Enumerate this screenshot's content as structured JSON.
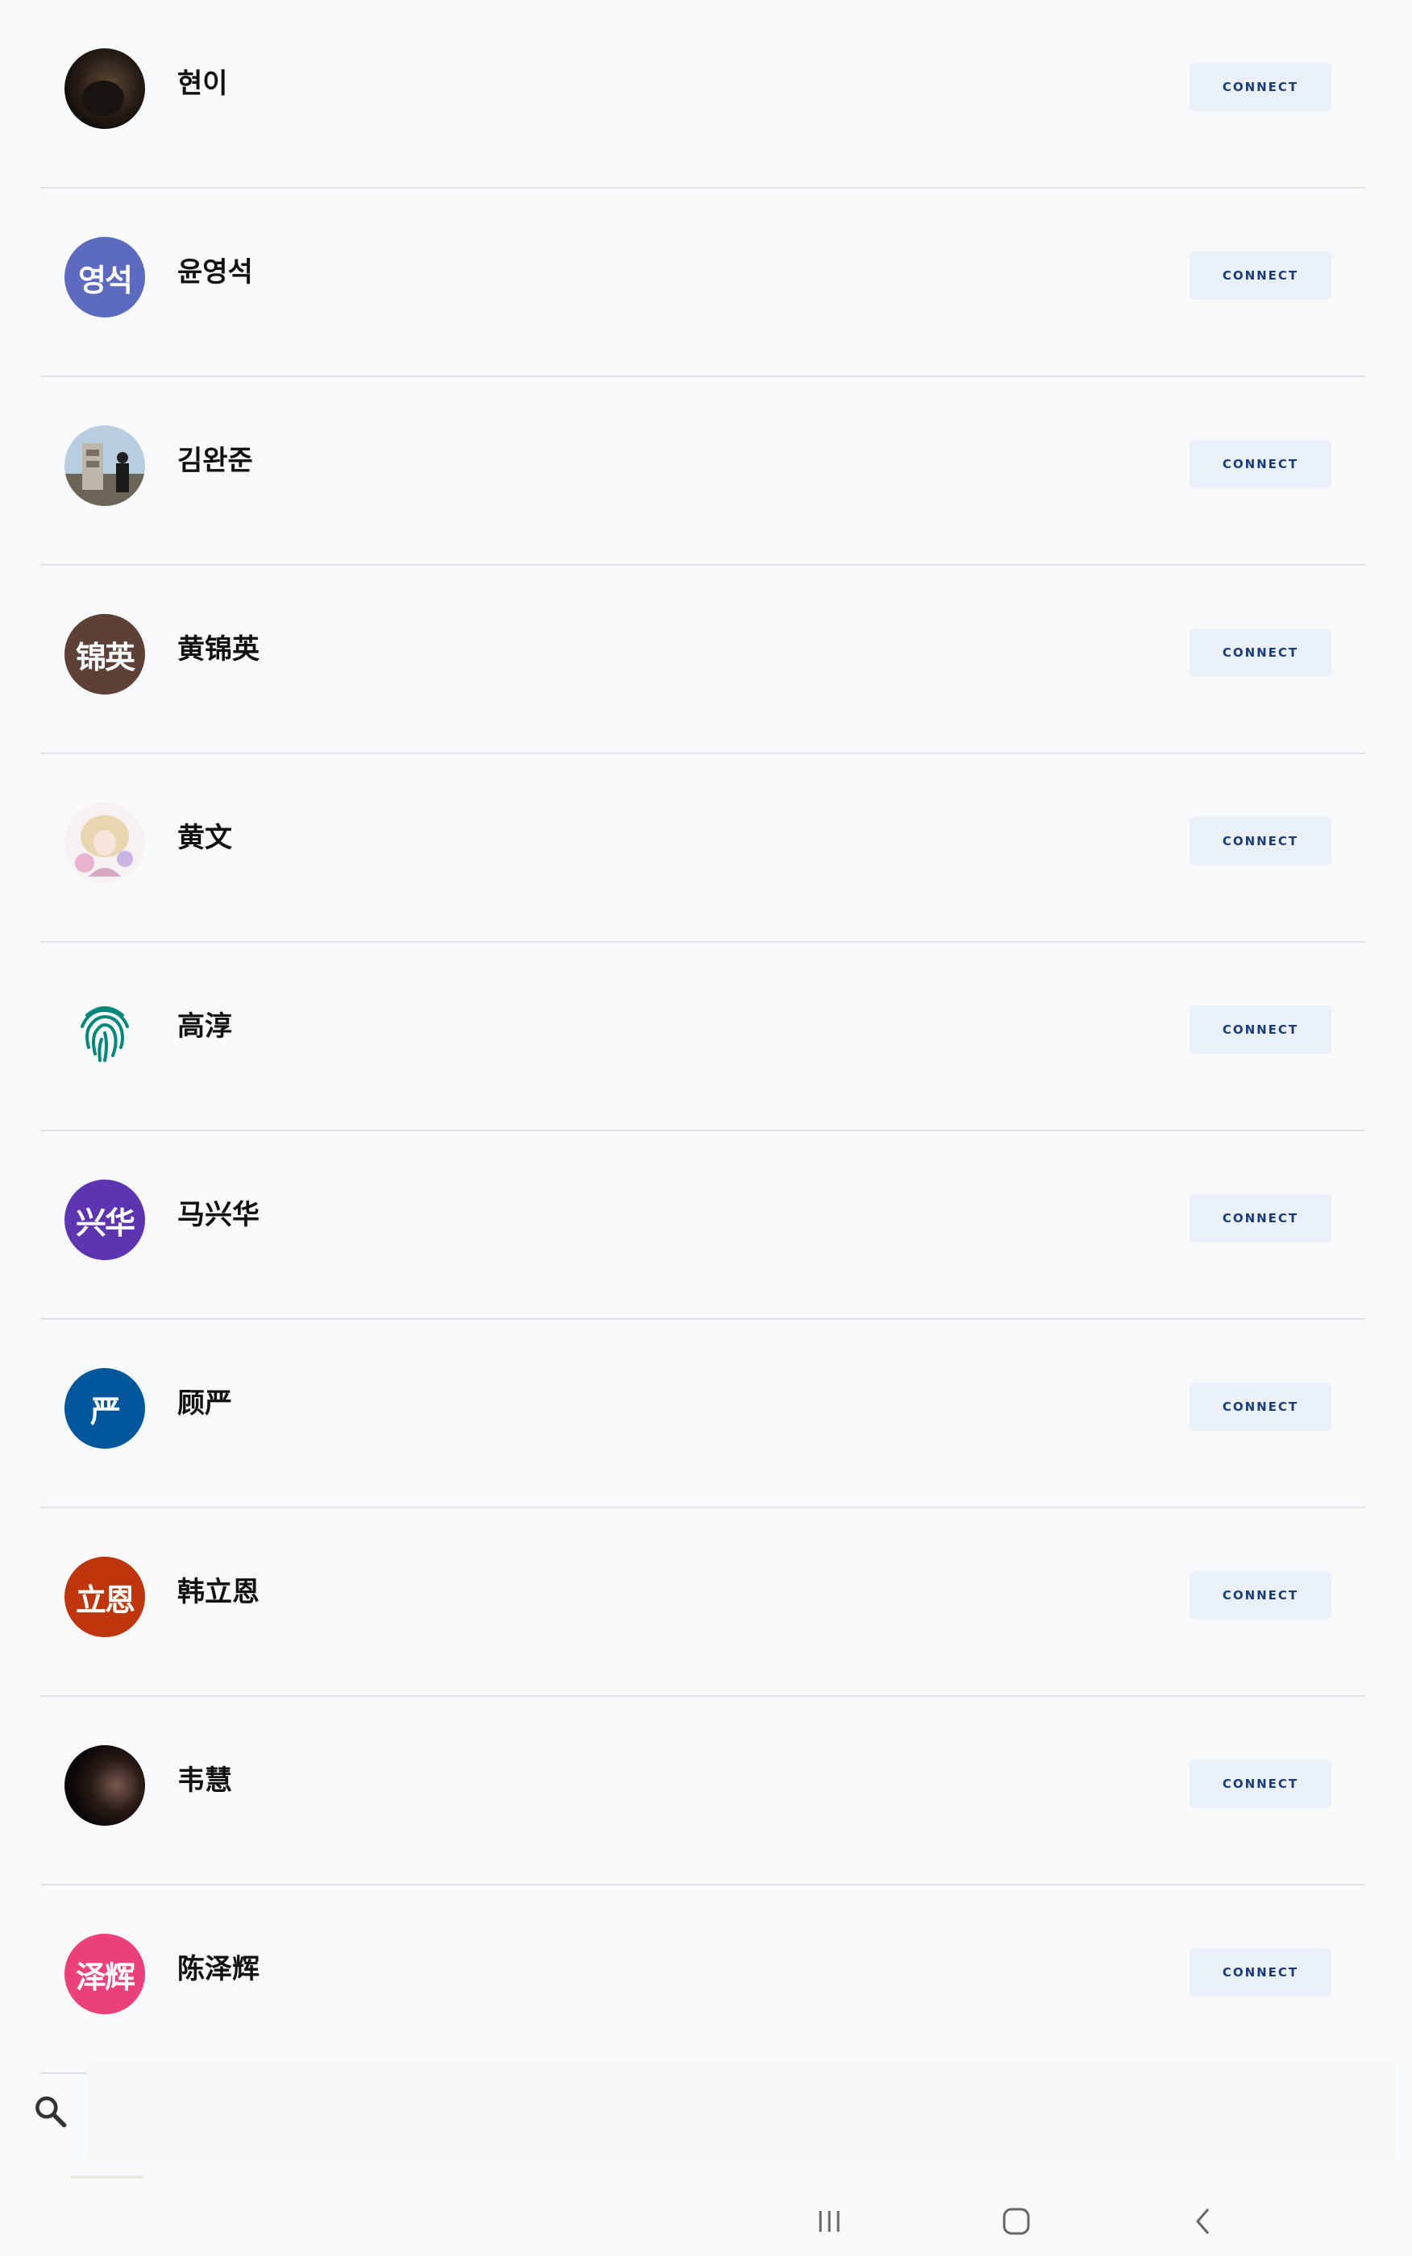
{
  "contacts": [
    {
      "name": "현이",
      "avatar": {
        "kind": "photo",
        "icon": "dark-portrait-photo",
        "text": ""
      },
      "button_label": "CONNECT"
    },
    {
      "name": "윤영석",
      "avatar": {
        "kind": "initials",
        "text": "영석",
        "color": "#5c6bc0"
      },
      "button_label": "CONNECT"
    },
    {
      "name": "김완준",
      "avatar": {
        "kind": "photo",
        "icon": "mountain-peak-photo",
        "text": ""
      },
      "button_label": "CONNECT"
    },
    {
      "name": "黄锦英",
      "avatar": {
        "kind": "initials",
        "text": "锦英",
        "color": "#5d4037"
      },
      "button_label": "CONNECT"
    },
    {
      "name": "黄文",
      "avatar": {
        "kind": "photo",
        "icon": "anime-illustration-photo",
        "text": ""
      },
      "button_label": "CONNECT"
    },
    {
      "name": "高淳",
      "avatar": {
        "kind": "icon",
        "icon": "fingerprint-icon",
        "text": "",
        "color": "#00897b"
      },
      "button_label": "CONNECT"
    },
    {
      "name": "马兴华",
      "avatar": {
        "kind": "initials",
        "text": "兴华",
        "color": "#5e35b1"
      },
      "button_label": "CONNECT"
    },
    {
      "name": "顾严",
      "avatar": {
        "kind": "initials",
        "text": "严",
        "color": "#01579b"
      },
      "button_label": "CONNECT"
    },
    {
      "name": "韩立恩",
      "avatar": {
        "kind": "initials",
        "text": "立恩",
        "color": "#bf360c"
      },
      "button_label": "CONNECT"
    },
    {
      "name": "韦慧",
      "avatar": {
        "kind": "photo",
        "icon": "dark-selfie-photo",
        "text": ""
      },
      "button_label": "CONNECT"
    },
    {
      "name": "陈泽辉",
      "avatar": {
        "kind": "initials",
        "text": "泽辉",
        "color": "#ec407a"
      },
      "button_label": "CONNECT"
    }
  ],
  "search": {
    "placeholder": "",
    "value": "",
    "icon": "search-icon"
  },
  "navigation_bar": {
    "buttons": [
      "recent-apps-icon",
      "home-icon",
      "back-icon"
    ]
  },
  "colors": {
    "button_bg": "#eaf0f8",
    "button_text": "#1a3d78",
    "divider": "#e1e4e8",
    "background": "#f8f9fa"
  }
}
